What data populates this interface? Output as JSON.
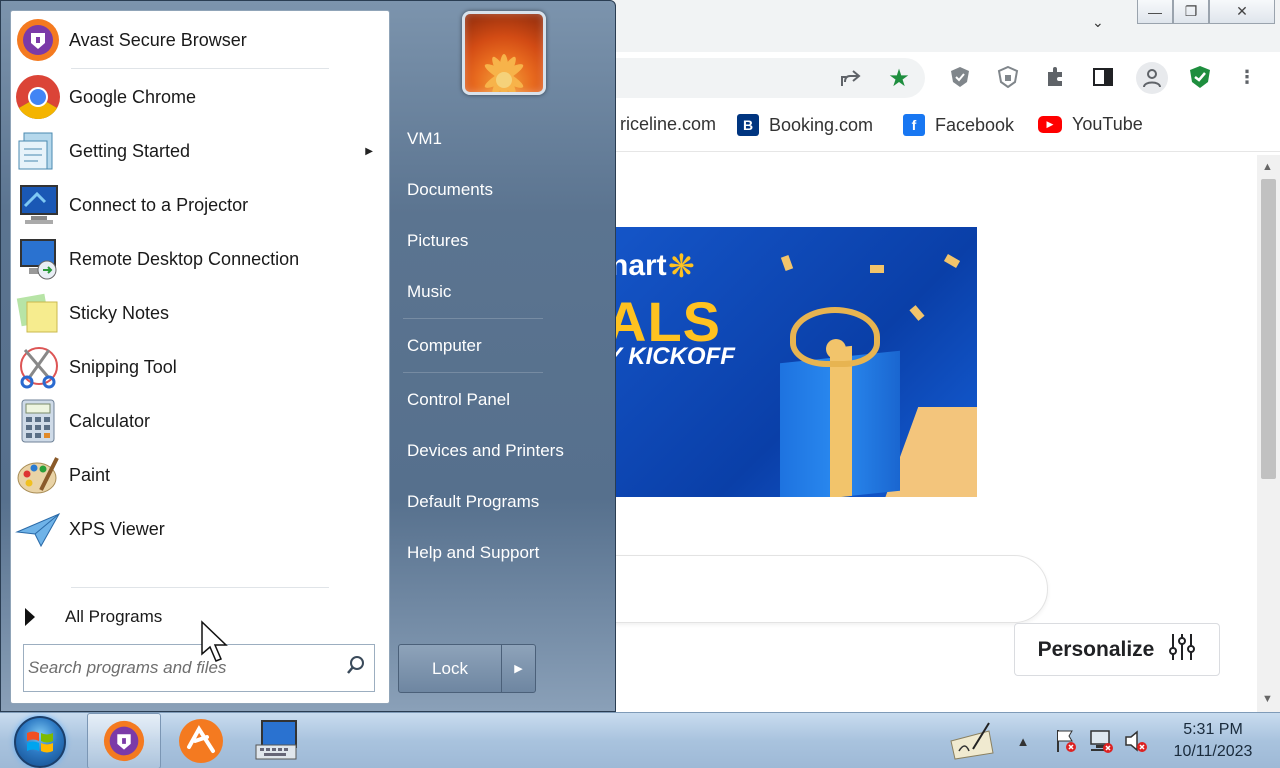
{
  "browser": {
    "bookmarks": [
      {
        "label": "riceline.com",
        "icon": "priceline-icon"
      },
      {
        "label": "Booking.com",
        "icon": "booking-icon"
      },
      {
        "label": "Facebook",
        "icon": "facebook-icon"
      },
      {
        "label": "YouTube",
        "icon": "youtube-icon"
      }
    ],
    "banner": {
      "line1": "nart",
      "line2": "ALS",
      "line3": "Y KICKOFF"
    },
    "personalize_label": "Personalize"
  },
  "start_menu": {
    "programs": [
      {
        "label": "Avast Secure Browser",
        "icon": "avast-browser-icon"
      },
      {
        "label": "Google Chrome",
        "icon": "chrome-icon"
      },
      {
        "label": "Getting Started",
        "icon": "getting-started-icon",
        "has_submenu": true
      },
      {
        "label": "Connect to a Projector",
        "icon": "projector-icon"
      },
      {
        "label": "Remote Desktop Connection",
        "icon": "remote-desktop-icon"
      },
      {
        "label": "Sticky Notes",
        "icon": "sticky-notes-icon"
      },
      {
        "label": "Snipping Tool",
        "icon": "snipping-tool-icon"
      },
      {
        "label": "Calculator",
        "icon": "calculator-icon"
      },
      {
        "label": "Paint",
        "icon": "paint-icon"
      },
      {
        "label": "XPS Viewer",
        "icon": "xps-viewer-icon"
      }
    ],
    "all_programs_label": "All Programs",
    "search_placeholder": "Search programs and files",
    "right_links": [
      {
        "label": "VM1"
      },
      {
        "label": "Documents"
      },
      {
        "label": "Pictures"
      },
      {
        "label": "Music"
      },
      {
        "label": "Computer"
      },
      {
        "label": "Control Panel"
      },
      {
        "label": "Devices and Printers"
      },
      {
        "label": "Default Programs"
      },
      {
        "label": "Help and Support"
      }
    ],
    "lock_label": "Lock"
  },
  "taskbar": {
    "time": "5:31 PM",
    "date": "10/11/2023"
  },
  "colors": {
    "chrome_blue": "#4285f4",
    "start_panel": "#5b7490",
    "taskbar": "#a9c3de"
  }
}
